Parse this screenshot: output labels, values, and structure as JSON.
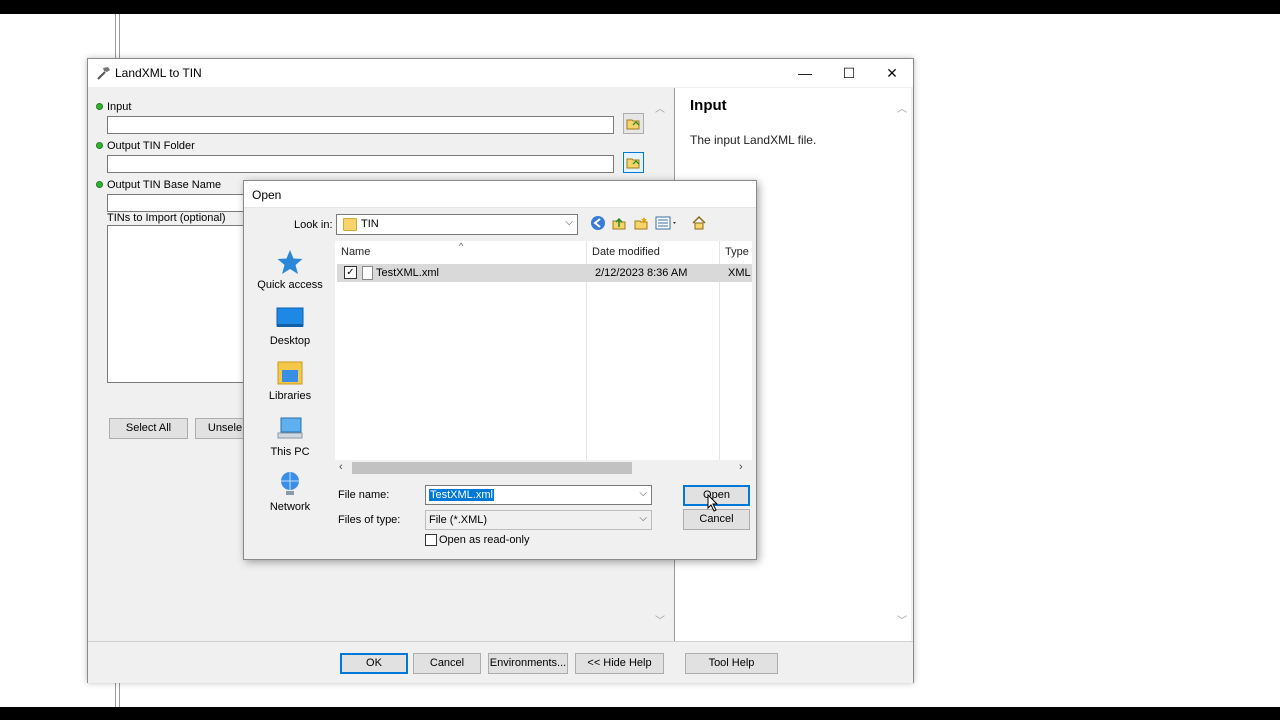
{
  "tool_window": {
    "title": "LandXML to TIN",
    "window_controls": {
      "minimize": "—",
      "maximize": "☐",
      "close": "✕"
    },
    "params": {
      "input_label": "Input",
      "output_folder_label": "Output TIN Folder",
      "output_base_label": "Output TIN Base Name",
      "tins_label": "TINs to Import (optional)",
      "select_all": "Select All",
      "unselect_all": "Unsele"
    },
    "help": {
      "title": "Input",
      "text": "The input LandXML file."
    },
    "buttons": {
      "ok": "OK",
      "cancel": "Cancel",
      "environments": "Environments...",
      "hide_help": "<< Hide Help",
      "tool_help": "Tool Help"
    }
  },
  "open_dialog": {
    "title": "Open",
    "look_in_label": "Look in:",
    "look_in_value": "TIN",
    "places": [
      {
        "label": "Quick access"
      },
      {
        "label": "Desktop"
      },
      {
        "label": "Libraries"
      },
      {
        "label": "This PC"
      },
      {
        "label": "Network"
      }
    ],
    "columns": {
      "name": "Name",
      "date": "Date modified",
      "type": "Type"
    },
    "files": [
      {
        "name": "TestXML.xml",
        "date": "2/12/2023 8:36 AM",
        "type": "XML",
        "checked": true
      }
    ],
    "file_name_label": "File name:",
    "file_name_value": "TestXML.xml",
    "file_type_label": "Files of type:",
    "file_type_value": "File (*.XML)",
    "read_only_label": "Open as read-only",
    "open_button": "Open",
    "cancel_button": "Cancel"
  },
  "colors": {
    "accent": "#0078d7",
    "required_dot": "#2fb52f",
    "folder": "#f6d46a"
  }
}
